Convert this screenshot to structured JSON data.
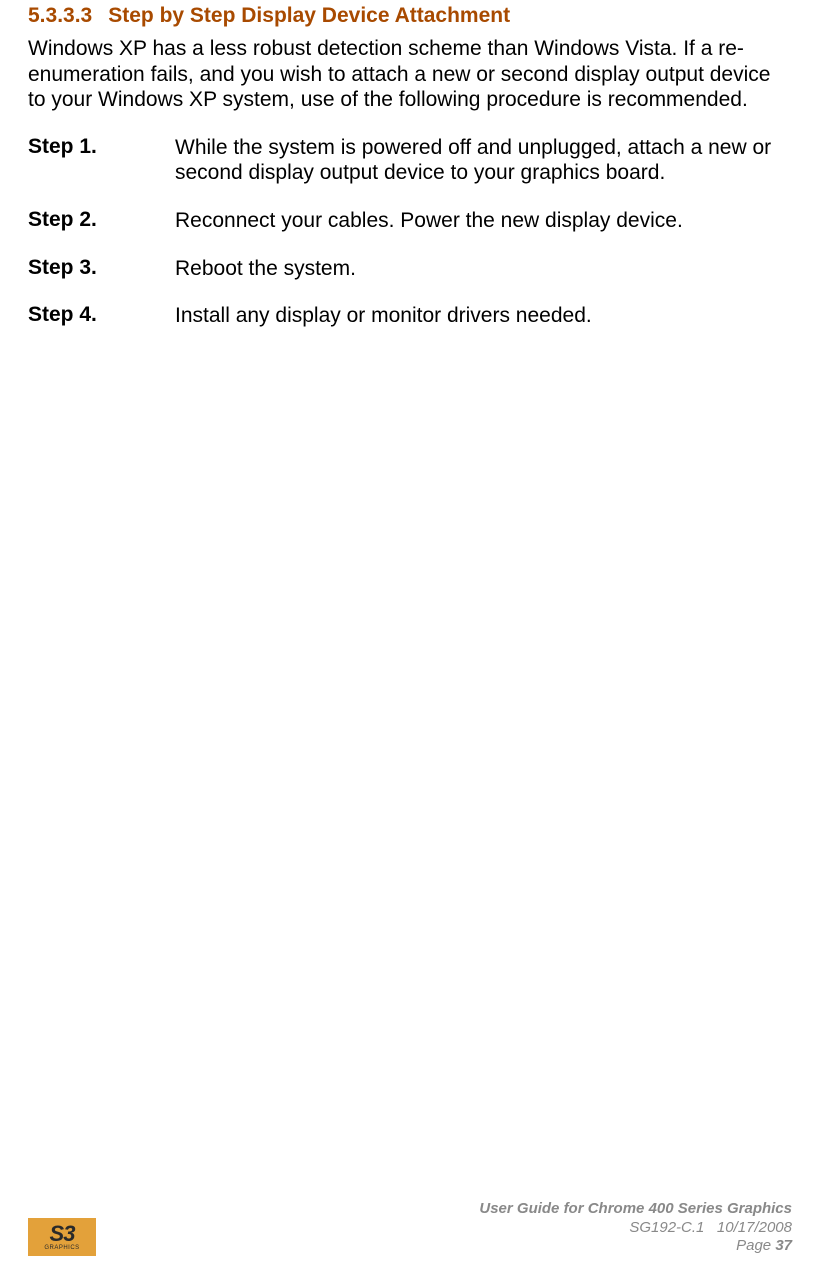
{
  "section": {
    "number": "5.3.3.3",
    "title": "Step by Step Display Device Attachment"
  },
  "intro": "Windows XP has a less robust detection scheme than Windows Vista. If a re-enumeration fails, and you wish to attach a new or second display output device to your Windows XP system, use of the following procedure is recommended.",
  "steps": [
    {
      "label": "Step 1.",
      "text": "While the system is powered off and unplugged, attach a new or second display output device to your graphics board."
    },
    {
      "label": "Step 2.",
      "text": "Reconnect your cables. Power the new display device."
    },
    {
      "label": "Step 3.",
      "text": "Reboot the system."
    },
    {
      "label": "Step 4.",
      "text": "Install any display or monitor drivers needed."
    }
  ],
  "footer": {
    "logo_main": "S3",
    "logo_sub": "GRAPHICS",
    "title": "User Guide for Chrome 400 Series Graphics",
    "doc_id": "SG192-C.1",
    "date": "10/17/2008",
    "page_label": "Page ",
    "page_number": "37"
  }
}
